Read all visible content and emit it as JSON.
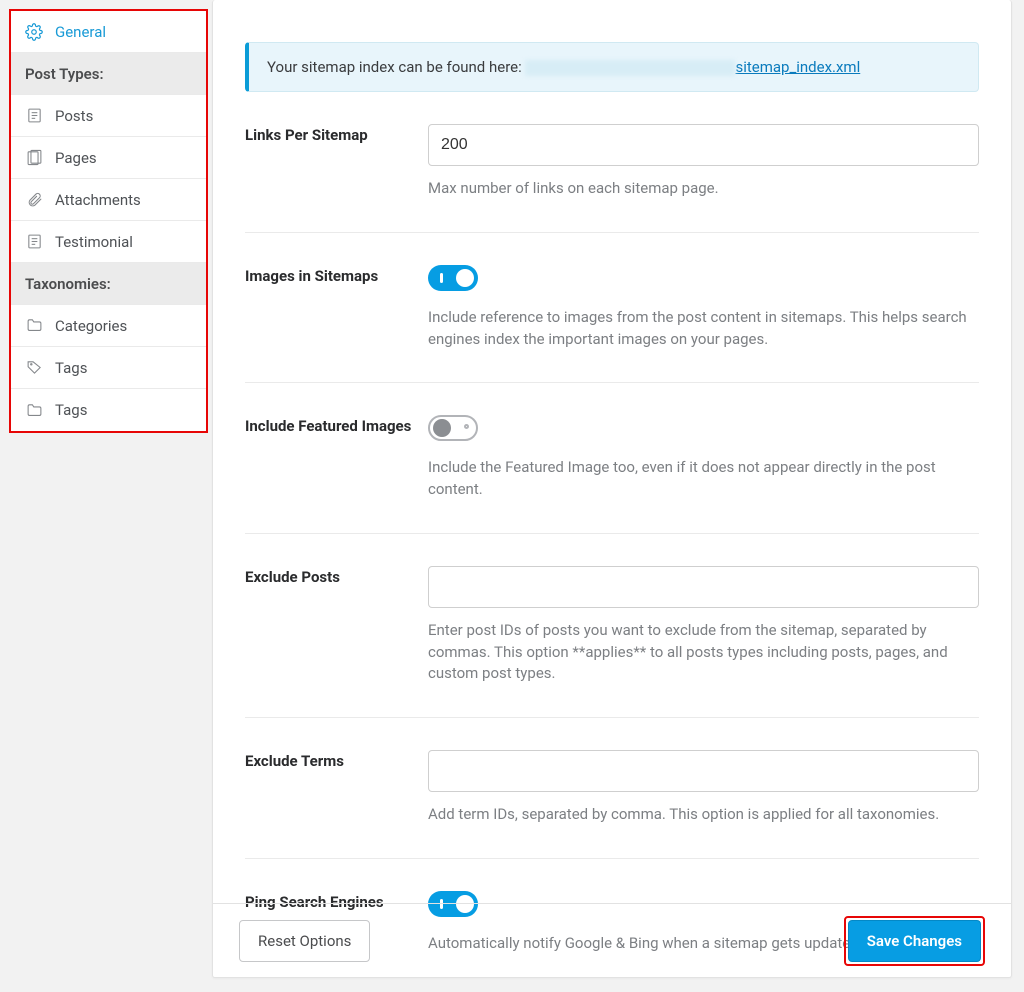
{
  "sidebar": {
    "items": [
      {
        "label": "General",
        "icon": "gear-icon",
        "active": true
      },
      {
        "label": "Post Types:",
        "group": true
      },
      {
        "label": "Posts",
        "icon": "post-icon"
      },
      {
        "label": "Pages",
        "icon": "page-icon"
      },
      {
        "label": "Attachments",
        "icon": "attachment-icon"
      },
      {
        "label": "Testimonial",
        "icon": "post-icon"
      },
      {
        "label": "Taxonomies:",
        "group": true
      },
      {
        "label": "Categories",
        "icon": "folder-icon"
      },
      {
        "label": "Tags",
        "icon": "tag-icon"
      },
      {
        "label": "Tags",
        "icon": "folder-icon"
      }
    ]
  },
  "notice": {
    "prefix": "Your sitemap index can be found here:",
    "link_text": "sitemap_index.xml"
  },
  "fields": {
    "links_per_sitemap": {
      "label": "Links Per Sitemap",
      "value": "200",
      "help": "Max number of links on each sitemap page."
    },
    "images_in_sitemaps": {
      "label": "Images in Sitemaps",
      "value": true,
      "help": "Include reference to images from the post content in sitemaps. This helps search engines index the important images on your pages."
    },
    "include_featured_images": {
      "label": "Include Featured Images",
      "value": false,
      "help": "Include the Featured Image too, even if it does not appear directly in the post content."
    },
    "exclude_posts": {
      "label": "Exclude Posts",
      "value": "",
      "help": "Enter post IDs of posts you want to exclude from the sitemap, separated by commas. This option **applies** to all posts types including posts, pages, and custom post types."
    },
    "exclude_terms": {
      "label": "Exclude Terms",
      "value": "",
      "help": "Add term IDs, separated by comma. This option is applied for all taxonomies."
    },
    "ping_search_engines": {
      "label": "Ping Search Engines",
      "value": true,
      "help": "Automatically notify Google & Bing when a sitemap gets updated."
    }
  },
  "footer": {
    "reset_label": "Reset Options",
    "save_label": "Save Changes"
  }
}
